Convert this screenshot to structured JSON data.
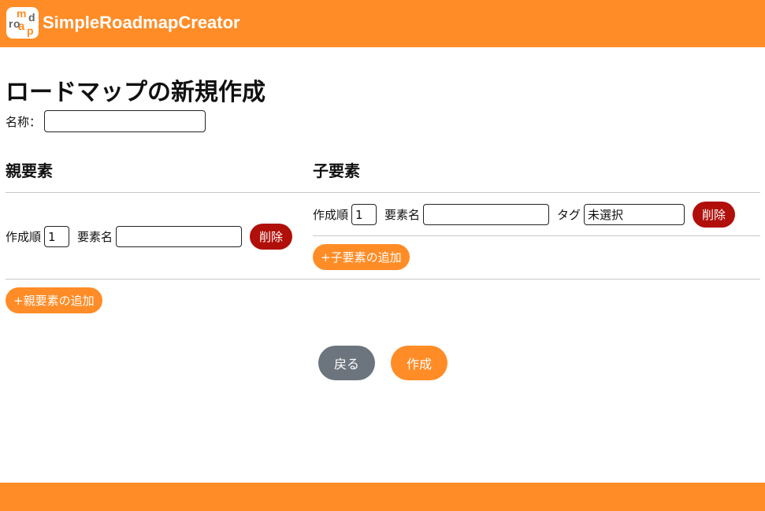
{
  "header": {
    "logo_letters": [
      "m",
      "a",
      "r",
      "o",
      "p",
      "d"
    ],
    "app_name": "SimpleRoadmapCreator"
  },
  "page": {
    "title": "ロードマップの新規作成",
    "name_label": "名称：",
    "name_value": ""
  },
  "parent": {
    "heading": "親要素",
    "item": {
      "order_label": "作成順",
      "order_value": "1",
      "element_label": "要素名",
      "element_value": "",
      "delete_label": "削除"
    },
    "add_label": "+親要素の追加"
  },
  "child": {
    "heading": "子要素",
    "item": {
      "order_label": "作成順",
      "order_value": "1",
      "element_label": "要素名",
      "element_value": "",
      "tag_label": "タグ",
      "tag_value": "未選択",
      "delete_label": "削除"
    },
    "add_label": "+子要素の追加"
  },
  "actions": {
    "back_label": "戻る",
    "create_label": "作成"
  },
  "colors": {
    "accent": "#ff8c26",
    "danger": "#b00f0a",
    "secondary": "#6c757d"
  }
}
